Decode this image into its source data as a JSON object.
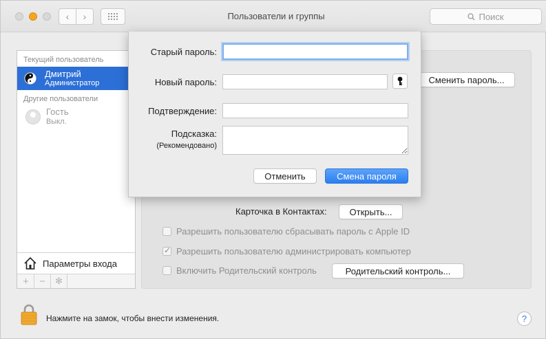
{
  "window": {
    "title": "Пользователи и группы",
    "search_placeholder": "Поиск"
  },
  "sidebar": {
    "current_header": "Текущий пользователь",
    "current_user": {
      "name": "Дмитрий",
      "role": "Администратор"
    },
    "others_header": "Другие пользователи",
    "guest": {
      "name": "Гость",
      "status": "Выкл."
    },
    "login_options_label": "Параметры входа"
  },
  "panel": {
    "change_password_button": "Сменить пароль...",
    "contacts_card_label": "Карточка в Контактах:",
    "open_button": "Открыть...",
    "options": [
      {
        "label": "Разрешить пользователю сбрасывать пароль с Apple ID",
        "checked": false
      },
      {
        "label": "Разрешить пользователю администрировать компьютер",
        "checked": true
      },
      {
        "label": "Включить Родительский контроль",
        "checked": false
      }
    ],
    "parental_button": "Родительский контроль..."
  },
  "footer": {
    "lock_text": "Нажмите на замок, чтобы внести изменения.",
    "help_label": "?"
  },
  "sheet": {
    "old_password_label": "Старый пароль:",
    "new_password_label": "Новый пароль:",
    "confirm_label": "Подтверждение:",
    "hint_label": "Подсказка:",
    "hint_sub_label": "(Рекомендовано)",
    "cancel_button": "Отменить",
    "submit_button": "Смена пароля"
  },
  "colors": {
    "accent": "#2c6fd6",
    "primary_button": "#2a7ff0",
    "focus_ring": "#7ab0f0",
    "lock": "#f0a830"
  }
}
